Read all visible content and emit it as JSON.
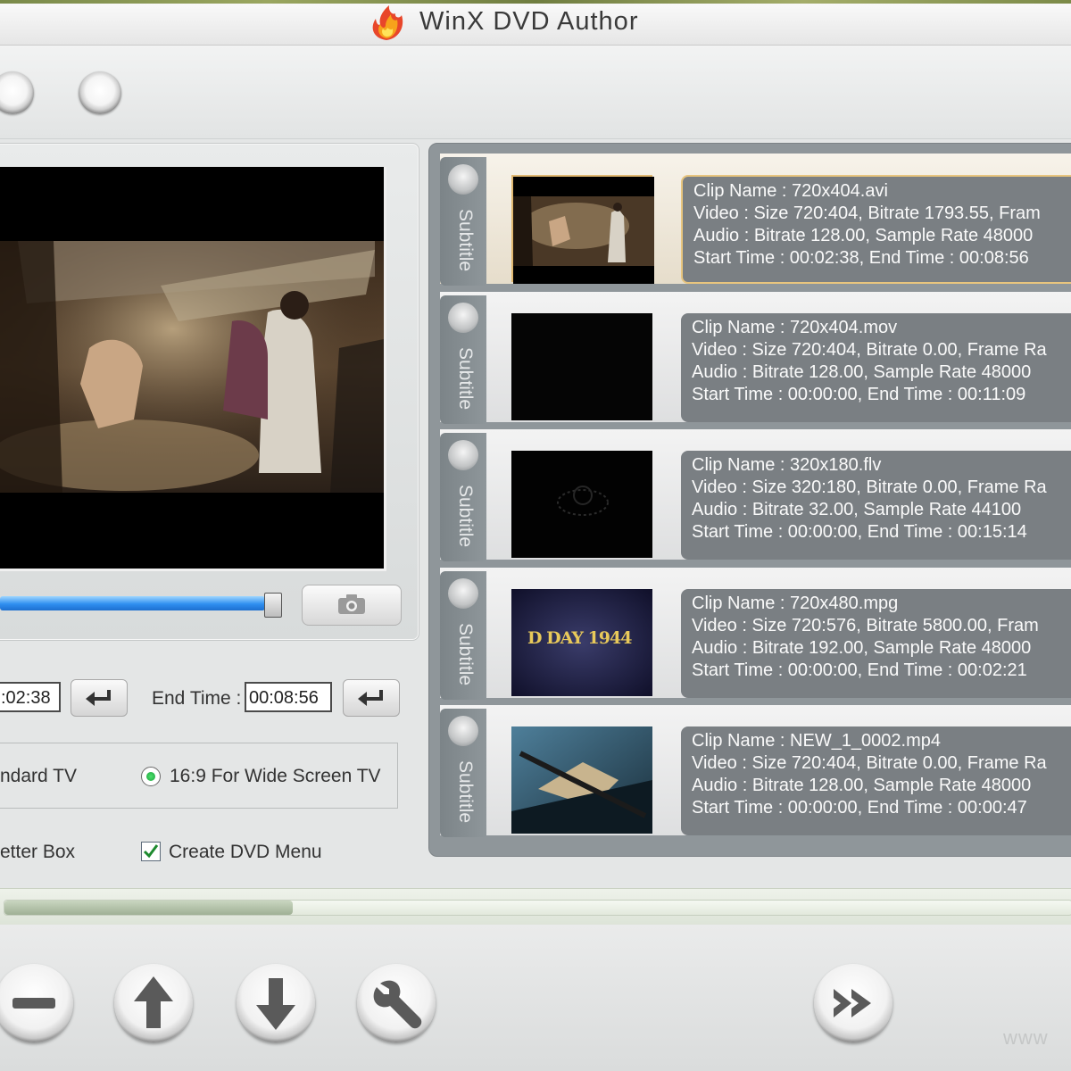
{
  "window": {
    "title": "WinX DVD Author"
  },
  "toolbar": {
    "buttons": [
      "round-button-1",
      "round-button-2"
    ]
  },
  "preview": {
    "progress_fraction": 0.97
  },
  "time_controls": {
    "start_time_value": ":02:38",
    "end_time_label": "End Time :",
    "end_time_value": "00:08:56"
  },
  "aspect_ratio": {
    "option_standard_label": "ndard TV",
    "option_wide_label": "16:9 For Wide Screen TV",
    "selected": "wide"
  },
  "options": {
    "letter_box_label": "etter Box",
    "create_menu_label": "Create DVD Menu",
    "create_menu_checked": true
  },
  "subtitle_label": "Subtitle",
  "clips": [
    {
      "name": "Clip Name : 720x404.avi",
      "video": "Video : Size 720:404, Bitrate 1793.55, Fram",
      "audio": "Audio : Bitrate 128.00, Sample Rate 48000",
      "times": "Start Time : 00:02:38, End Time : 00:08:56",
      "selected": true,
      "thumb": "market-scene"
    },
    {
      "name": "Clip Name : 720x404.mov",
      "video": "Video : Size 720:404, Bitrate 0.00, Frame Ra",
      "audio": "Audio : Bitrate 128.00, Sample Rate 48000",
      "times": "Start Time : 00:00:00, End Time : 00:11:09",
      "selected": false,
      "thumb": "black"
    },
    {
      "name": "Clip Name : 320x180.flv",
      "video": "Video : Size 320:180, Bitrate 0.00, Frame Ra",
      "audio": "Audio : Bitrate 32.00, Sample Rate 44100",
      "times": "Start Time : 00:00:00, End Time : 00:15:14",
      "selected": false,
      "thumb": "dark-logo"
    },
    {
      "name": "Clip Name : 720x480.mpg",
      "video": "Video : Size 720:576, Bitrate 5800.00, Fram",
      "audio": "Audio : Bitrate 192.00, Sample Rate 48000",
      "times": "Start Time : 00:00:00, End Time : 00:02:21",
      "selected": false,
      "thumb": "title-card",
      "thumb_text": "D DAY 1944"
    },
    {
      "name": "Clip Name : NEW_1_0002.mp4",
      "video": "Video : Size 720:404, Bitrate 0.00, Frame Ra",
      "audio": "Audio : Bitrate 128.00, Sample Rate 48000",
      "times": "Start Time : 00:00:00, End Time : 00:00:47",
      "selected": false,
      "thumb": "soldier-scene"
    }
  ],
  "bottom": {
    "progress_fraction": 0.27,
    "buttons": [
      "remove-icon",
      "move-up-icon",
      "move-down-icon",
      "settings-wrench-icon",
      "next-icon"
    ],
    "watermark": "www"
  },
  "colors": {
    "accent_blue": "#2f8ff0",
    "info_box_bg": "#7a7f83",
    "selected_border": "#e8c57e"
  }
}
